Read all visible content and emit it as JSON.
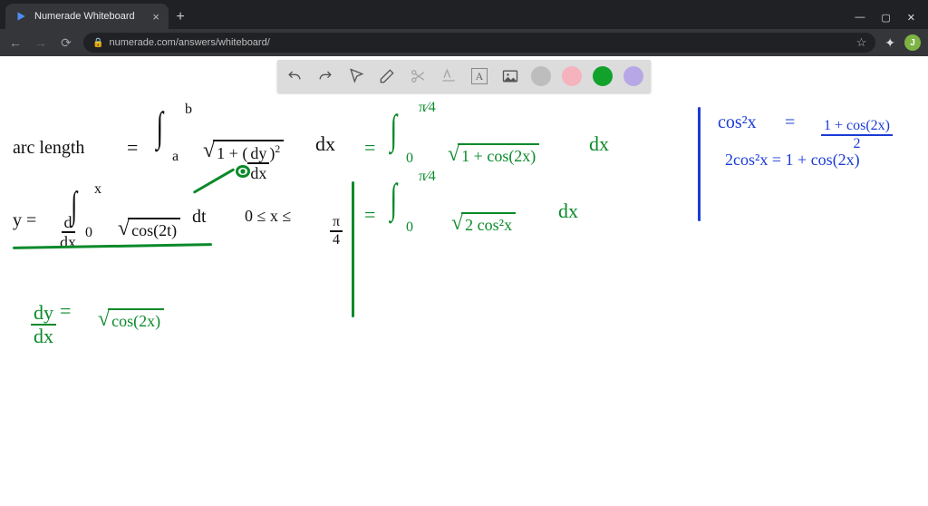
{
  "browser": {
    "tab_title": "Numerade Whiteboard",
    "url": "numerade.com/answers/whiteboard/",
    "window_controls": {
      "min": "—",
      "max": "▢",
      "close": "✕"
    },
    "nav": {
      "back": "←",
      "forward": "→",
      "reload": "⟳"
    },
    "new_tab": "+",
    "tab_close": "×",
    "star": "☆",
    "puzzle": "✦",
    "avatar_initial": "J"
  },
  "toolbar": {
    "undo_title": "Undo",
    "redo_title": "Redo",
    "pointer_title": "Pointer",
    "eraser_title": "Eraser",
    "scissors_title": "Cut",
    "smudge_title": "Smudge",
    "text_title": "Text",
    "text_glyph": "A",
    "image_title": "Image",
    "colors": {
      "gray": "#bdbdbd",
      "pink": "#f5b3bd",
      "green": "#12a22c",
      "purple": "#b7a7e6"
    },
    "active_color": "green"
  },
  "math": {
    "arc_label": "arc length",
    "eq": "=",
    "int_a": "a",
    "int_b": "b",
    "one_plus": "1 +",
    "dy": "dy",
    "dx_small": "dx",
    "sq": "2",
    "dx": "dx",
    "int_0": "0",
    "int_pi4": "π⁄4",
    "one_plus_cos2x": "1 + cos(2x)",
    "y_eq": "y =",
    "ddx_num": "d",
    "ddx_den": "dx",
    "int_x": "x",
    "cos2t": "cos(2t)",
    "dt": "dt",
    "range": "0 ≤ x ≤",
    "two_cos2x": "2 cos²x",
    "dy_over_dx": "dy",
    "dy_over_dx_den": "dx",
    "sqrt_cos2x": "cos(2x)",
    "ident_lhs": "cos²x",
    "ident_rhs_num": "1 + cos(2x)",
    "ident_rhs_den": "2",
    "ident2": "2cos²x = 1 + cos(2x)"
  }
}
